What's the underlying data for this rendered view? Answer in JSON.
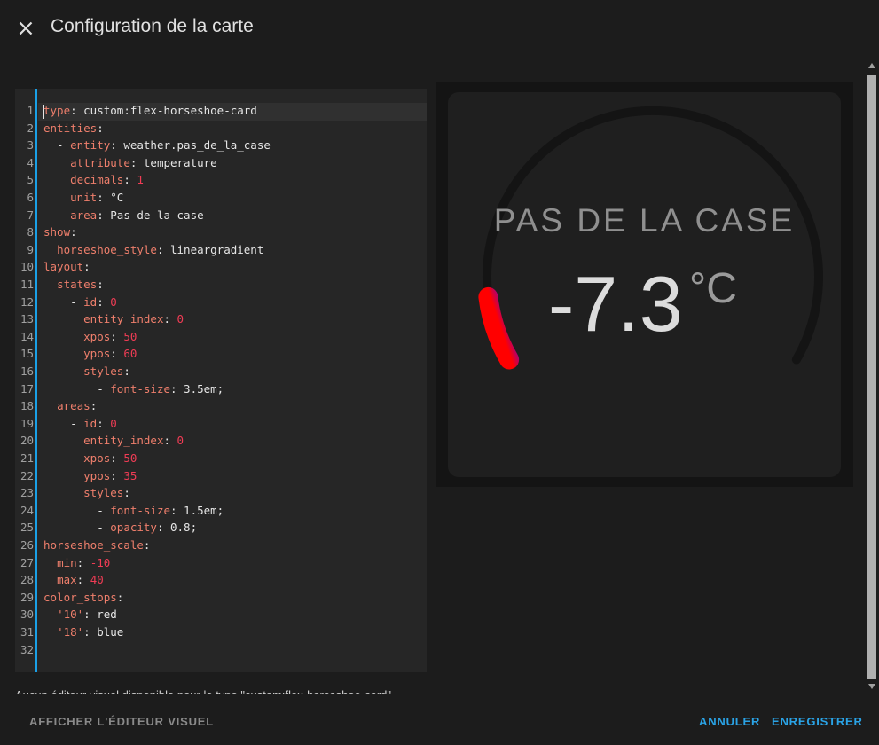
{
  "dialog": {
    "title": "Configuration de la carte",
    "close_icon": "close-icon"
  },
  "editor": {
    "active_line": 1,
    "lines": [
      [
        [
          "k",
          "type"
        ],
        [
          "v",
          ": custom:flex-horseshoe-card"
        ]
      ],
      [
        [
          "k",
          "entities"
        ],
        [
          "v",
          ":"
        ]
      ],
      [
        [
          "v",
          "  - "
        ],
        [
          "k",
          "entity"
        ],
        [
          "v",
          ": weather.pas_de_la_case"
        ]
      ],
      [
        [
          "v",
          "    "
        ],
        [
          "k",
          "attribute"
        ],
        [
          "v",
          ": temperature"
        ]
      ],
      [
        [
          "v",
          "    "
        ],
        [
          "k",
          "decimals"
        ],
        [
          "v",
          ": "
        ],
        [
          "n",
          "1"
        ]
      ],
      [
        [
          "v",
          "    "
        ],
        [
          "k",
          "unit"
        ],
        [
          "v",
          ": °C"
        ]
      ],
      [
        [
          "v",
          "    "
        ],
        [
          "k",
          "area"
        ],
        [
          "v",
          ": Pas de la case"
        ]
      ],
      [
        [
          "k",
          "show"
        ],
        [
          "v",
          ":"
        ]
      ],
      [
        [
          "v",
          "  "
        ],
        [
          "k",
          "horseshoe_style"
        ],
        [
          "v",
          ": lineargradient"
        ]
      ],
      [
        [
          "k",
          "layout"
        ],
        [
          "v",
          ":"
        ]
      ],
      [
        [
          "v",
          "  "
        ],
        [
          "k",
          "states"
        ],
        [
          "v",
          ":"
        ]
      ],
      [
        [
          "v",
          "    - "
        ],
        [
          "k",
          "id"
        ],
        [
          "v",
          ": "
        ],
        [
          "n",
          "0"
        ]
      ],
      [
        [
          "v",
          "      "
        ],
        [
          "k",
          "entity_index"
        ],
        [
          "v",
          ": "
        ],
        [
          "n",
          "0"
        ]
      ],
      [
        [
          "v",
          "      "
        ],
        [
          "k",
          "xpos"
        ],
        [
          "v",
          ": "
        ],
        [
          "n",
          "50"
        ]
      ],
      [
        [
          "v",
          "      "
        ],
        [
          "k",
          "ypos"
        ],
        [
          "v",
          ": "
        ],
        [
          "n",
          "60"
        ]
      ],
      [
        [
          "v",
          "      "
        ],
        [
          "k",
          "styles"
        ],
        [
          "v",
          ":"
        ]
      ],
      [
        [
          "v",
          "        - "
        ],
        [
          "k",
          "font-size"
        ],
        [
          "v",
          ": 3.5em;"
        ]
      ],
      [
        [
          "v",
          "  "
        ],
        [
          "k",
          "areas"
        ],
        [
          "v",
          ":"
        ]
      ],
      [
        [
          "v",
          "    - "
        ],
        [
          "k",
          "id"
        ],
        [
          "v",
          ": "
        ],
        [
          "n",
          "0"
        ]
      ],
      [
        [
          "v",
          "      "
        ],
        [
          "k",
          "entity_index"
        ],
        [
          "v",
          ": "
        ],
        [
          "n",
          "0"
        ]
      ],
      [
        [
          "v",
          "      "
        ],
        [
          "k",
          "xpos"
        ],
        [
          "v",
          ": "
        ],
        [
          "n",
          "50"
        ]
      ],
      [
        [
          "v",
          "      "
        ],
        [
          "k",
          "ypos"
        ],
        [
          "v",
          ": "
        ],
        [
          "n",
          "35"
        ]
      ],
      [
        [
          "v",
          "      "
        ],
        [
          "k",
          "styles"
        ],
        [
          "v",
          ":"
        ]
      ],
      [
        [
          "v",
          "        - "
        ],
        [
          "k",
          "font-size"
        ],
        [
          "v",
          ": 1.5em;"
        ]
      ],
      [
        [
          "v",
          "        - "
        ],
        [
          "k",
          "opacity"
        ],
        [
          "v",
          ": 0.8;"
        ]
      ],
      [
        [
          "k",
          "horseshoe_scale"
        ],
        [
          "v",
          ":"
        ]
      ],
      [
        [
          "v",
          "  "
        ],
        [
          "k",
          "min"
        ],
        [
          "v",
          ": "
        ],
        [
          "n",
          "-10"
        ]
      ],
      [
        [
          "v",
          "  "
        ],
        [
          "k",
          "max"
        ],
        [
          "v",
          ": "
        ],
        [
          "n",
          "40"
        ]
      ],
      [
        [
          "k",
          "color_stops"
        ],
        [
          "v",
          ":"
        ]
      ],
      [
        [
          "v",
          "  "
        ],
        [
          "k",
          "'10'"
        ],
        [
          "v",
          ": red"
        ]
      ],
      [
        [
          "v",
          "  "
        ],
        [
          "k",
          "'18'"
        ],
        [
          "v",
          ": blue"
        ]
      ],
      []
    ]
  },
  "preview": {
    "area_label": "PAS DE LA CASE",
    "value": "-7.3",
    "unit": "°C",
    "scale_min": -10,
    "scale_max": 40,
    "current_value": -7.3,
    "gradient_colors": [
      "#ff0000",
      "#4b00ff"
    ],
    "track_color": "#141414"
  },
  "partial_text": "Aucun éditeur visuel disponible pour le type \"custom:flex-horseshoe-card\"",
  "footer": {
    "visual_editor_label": "AFFICHER L'ÉDITEUR VISUEL",
    "cancel_label": "ANNULER",
    "save_label": "ENREGISTRER"
  }
}
